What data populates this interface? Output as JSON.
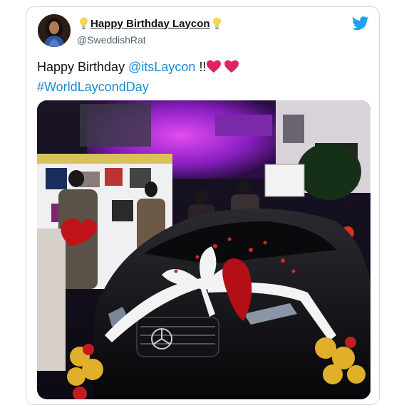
{
  "tweet": {
    "display_name": "Happy Birthday Laycon",
    "handle": "@SweddishRat",
    "text_prefix": "Happy Birthday",
    "mention": "@itsLaycon",
    "text_suffix": "!!",
    "hashtag": "#WorldLaycondDay"
  },
  "icons": {
    "name_prefix": "lightbulb-icon",
    "name_suffix": "lightbulb-icon",
    "brand": "twitter-bird-icon",
    "emoji": "red-heart-icon"
  },
  "colors": {
    "link": "#1b8bd6",
    "brand": "#1da1f2",
    "heart": "#e0245e"
  }
}
